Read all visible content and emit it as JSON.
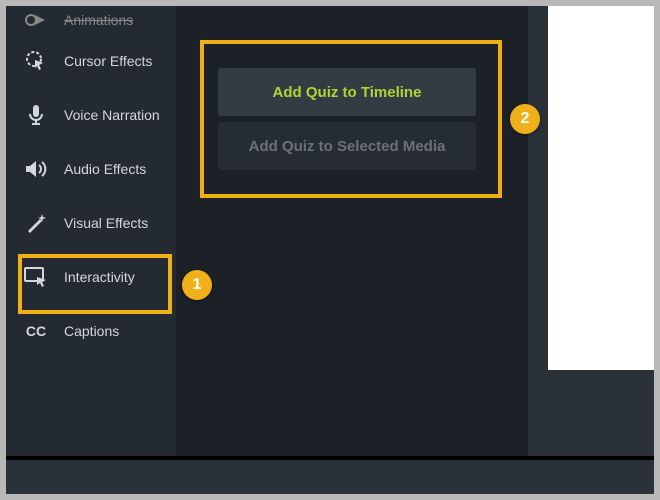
{
  "sidebar": {
    "items": [
      {
        "label": "Animations",
        "icon": "animations-icon"
      },
      {
        "label": "Cursor Effects",
        "icon": "cursor-effects-icon"
      },
      {
        "label": "Voice Narration",
        "icon": "voice-narration-icon"
      },
      {
        "label": "Audio Effects",
        "icon": "audio-effects-icon"
      },
      {
        "label": "Visual Effects",
        "icon": "visual-effects-icon"
      },
      {
        "label": "Interactivity",
        "icon": "interactivity-icon"
      },
      {
        "label": "Captions",
        "icon": "captions-icon"
      }
    ]
  },
  "main": {
    "add_quiz_timeline": "Add Quiz to Timeline",
    "add_quiz_selected": "Add Quiz to Selected Media"
  },
  "callouts": {
    "marker1": "1",
    "marker2": "2"
  },
  "colors": {
    "accent": "#b3d334",
    "highlight": "#efb017"
  }
}
